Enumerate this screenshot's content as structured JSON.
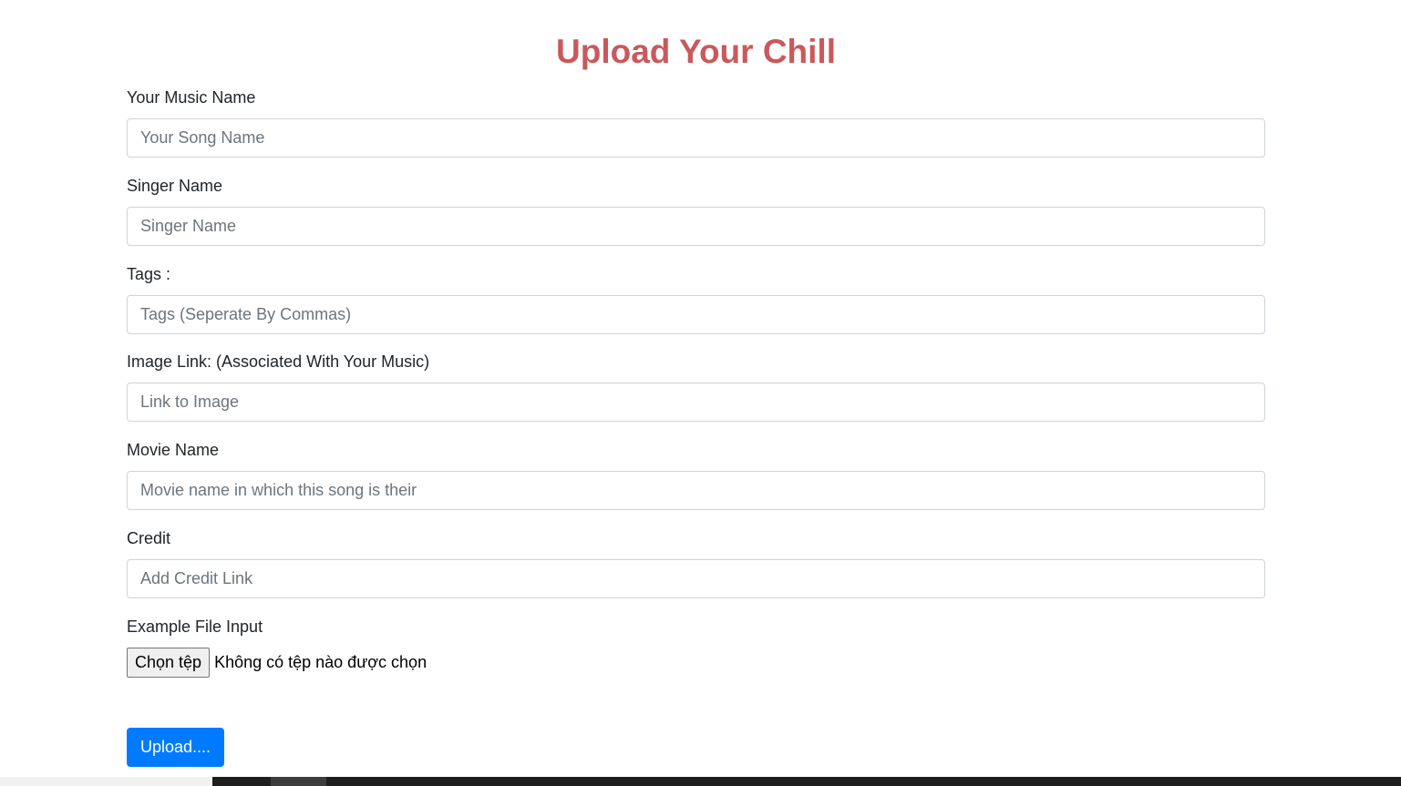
{
  "title": "Upload Your Chill",
  "fields": {
    "music_name": {
      "label": "Your Music Name",
      "placeholder": "Your Song Name",
      "value": ""
    },
    "singer_name": {
      "label": "Singer Name",
      "placeholder": "Singer Name",
      "value": ""
    },
    "tags": {
      "label": "Tags :",
      "placeholder": "Tags (Seperate By Commas)",
      "value": ""
    },
    "image_link": {
      "label": "Image Link: (Associated With Your Music)",
      "placeholder": "Link to Image",
      "value": ""
    },
    "movie_name": {
      "label": "Movie Name",
      "placeholder": "Movie name in which this song is their",
      "value": ""
    },
    "credit": {
      "label": "Credit",
      "placeholder": "Add Credit Link",
      "value": ""
    }
  },
  "file_input": {
    "label": "Example File Input",
    "button_label": "Chọn tệp",
    "status": "Không có tệp nào được chọn"
  },
  "upload_button": {
    "label": "Upload...."
  },
  "colors": {
    "title": "#c9595c",
    "primary": "#007bff",
    "input_border": "#ced4da",
    "placeholder": "#6c757d"
  }
}
